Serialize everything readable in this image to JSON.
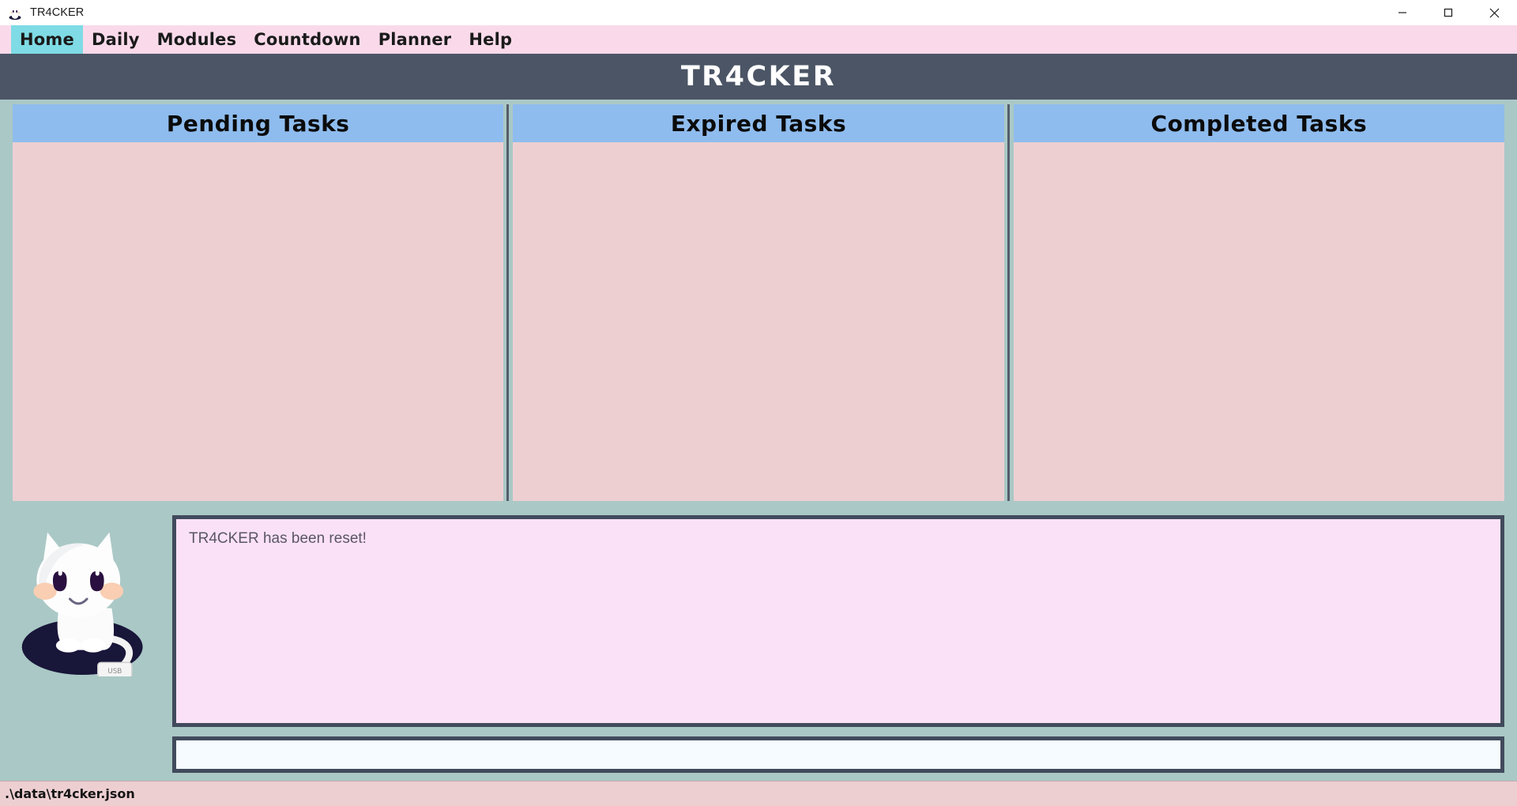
{
  "window": {
    "title": "TR4CKER",
    "icon": "cat-mascot-icon",
    "controls": {
      "minimize": "minimize-icon",
      "maximize": "maximize-icon",
      "close": "close-icon"
    }
  },
  "menubar": {
    "items": [
      {
        "label": "Home",
        "active": true
      },
      {
        "label": "Daily",
        "active": false
      },
      {
        "label": "Modules",
        "active": false
      },
      {
        "label": "Countdown",
        "active": false
      },
      {
        "label": "Planner",
        "active": false
      },
      {
        "label": "Help",
        "active": false
      }
    ]
  },
  "banner": {
    "title": "TR4CKER"
  },
  "panels": [
    {
      "title": "Pending Tasks",
      "tasks": []
    },
    {
      "title": "Expired Tasks",
      "tasks": []
    },
    {
      "title": "Completed Tasks",
      "tasks": []
    }
  ],
  "mascot": {
    "name": "white-cat-mascot"
  },
  "message_box": {
    "text": "TR4CKER has been reset!"
  },
  "command_input": {
    "value": "",
    "placeholder": ""
  },
  "statusbar": {
    "path": ".\\data\\tr4cker.json"
  },
  "colors": {
    "app_background": "#aac8c6",
    "menubar": "#fadaea",
    "menu_active": "#7fdbe5",
    "banner": "#4b5565",
    "panel_header": "#8fbcee",
    "panel_body": "#edcfd2",
    "message_box": "#fbe1f7",
    "input_box": "#f5fbff",
    "border": "#414b5c",
    "statusbar": "#edcfd2"
  }
}
